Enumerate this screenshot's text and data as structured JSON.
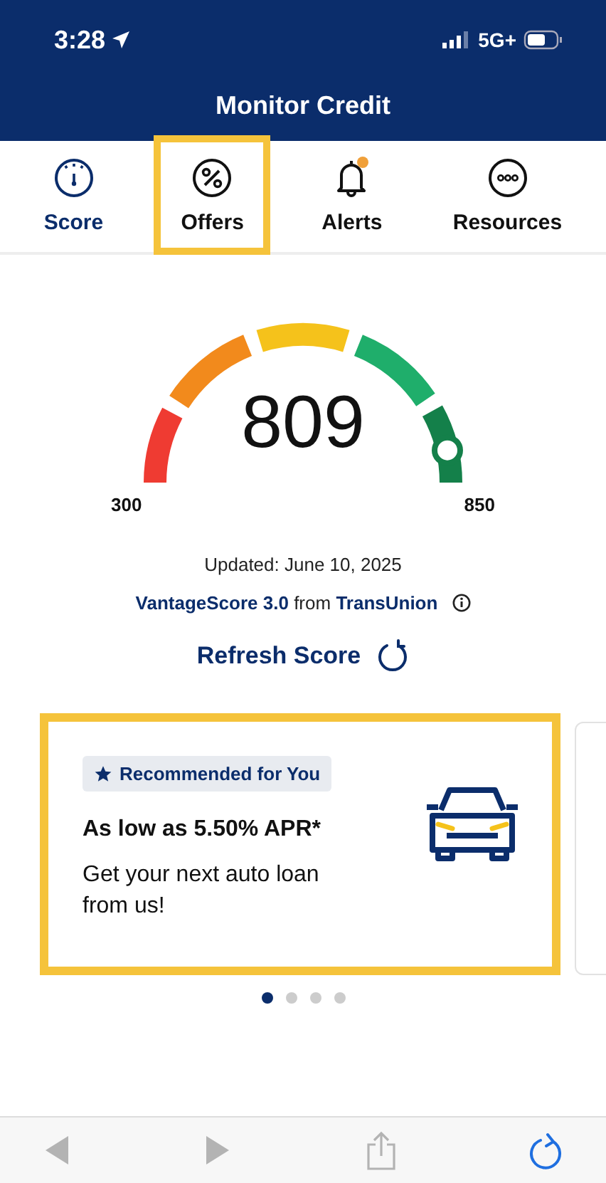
{
  "status_bar": {
    "time": "3:28",
    "network": "5G+"
  },
  "header": {
    "title": "Monitor Credit"
  },
  "tabs": [
    {
      "label": "Score",
      "kind": "gauge",
      "selected": true,
      "highlighted": false,
      "badge": false
    },
    {
      "label": "Offers",
      "kind": "percent",
      "selected": false,
      "highlighted": true,
      "badge": false
    },
    {
      "label": "Alerts",
      "kind": "bell",
      "selected": false,
      "highlighted": false,
      "badge": true
    },
    {
      "label": "Resources",
      "kind": "more",
      "selected": false,
      "highlighted": false,
      "badge": false
    }
  ],
  "gauge": {
    "score": "809",
    "min_label": "300",
    "max_label": "850"
  },
  "updated": "Updated: June 10, 2025",
  "source": "**VantageScore 3.0** from **TransUnion**",
  "refresh": {
    "label": "Refresh Score"
  },
  "offer_card": {
    "tag": "Recommended for You",
    "headline": "As low as 5.50% APR*",
    "body": "Get your next auto loan from us!",
    "highlighted": true
  },
  "pager": [
    {
      "selected": true
    },
    {
      "selected": false
    },
    {
      "selected": false
    },
    {
      "selected": false
    }
  ],
  "browser_toolbar": [
    {
      "kind": "back",
      "disabled": true
    },
    {
      "kind": "forward",
      "disabled": true
    },
    {
      "kind": "share",
      "disabled": true
    },
    {
      "kind": "reload",
      "disabled": false
    }
  ]
}
